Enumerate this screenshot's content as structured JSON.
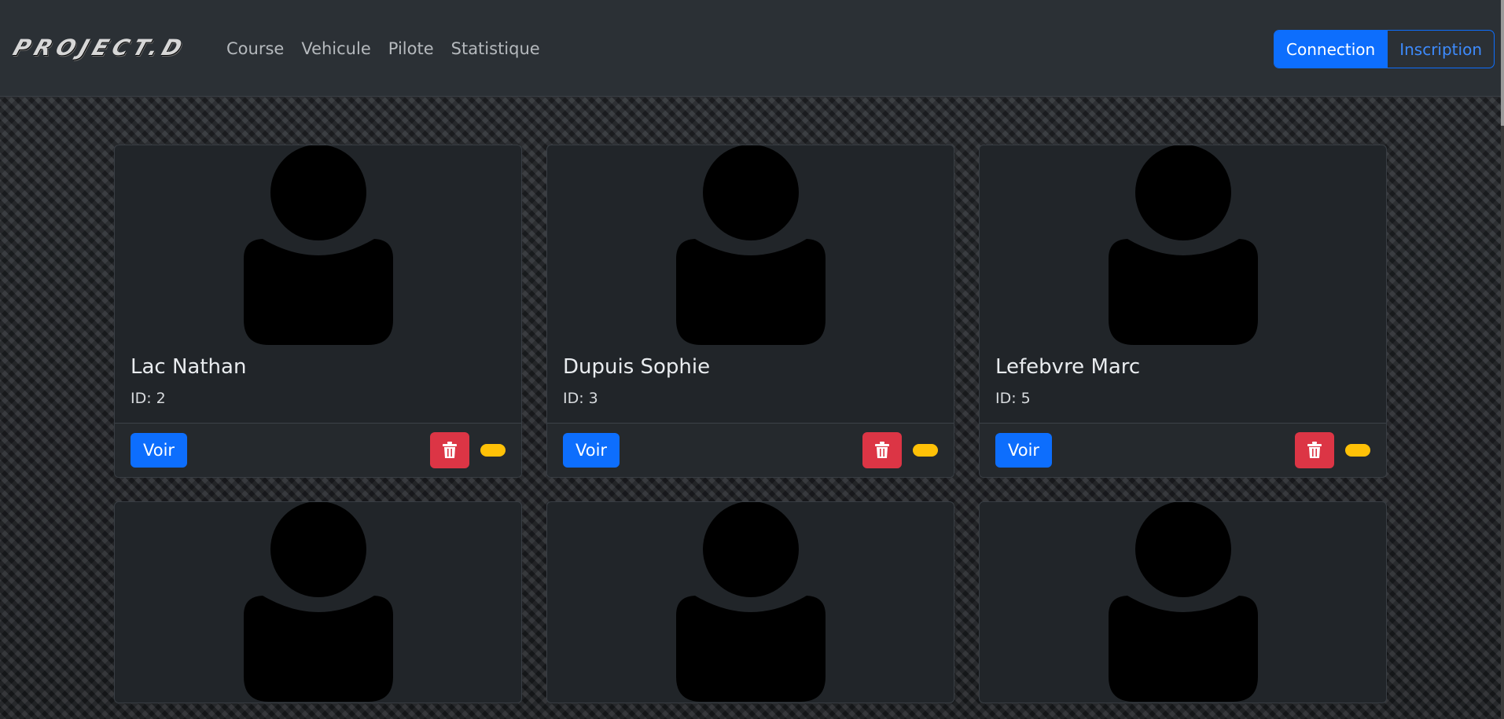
{
  "brand": "PROJECT.D",
  "nav": {
    "links": [
      "Course",
      "Vehicule",
      "Pilote",
      "Statistique"
    ]
  },
  "auth": {
    "connection": "Connection",
    "inscription": "Inscription"
  },
  "cards": [
    {
      "name": "Lac Nathan",
      "id": "ID: 2",
      "view": "Voir"
    },
    {
      "name": "Dupuis Sophie",
      "id": "ID: 3",
      "view": "Voir"
    },
    {
      "name": "Lefebvre Marc",
      "id": "ID: 5",
      "view": "Voir"
    }
  ],
  "icons": {
    "avatar": "person-silhouette-icon",
    "delete": "trash-icon"
  },
  "colors": {
    "primary": "#0d6efd",
    "danger": "#dc3545",
    "warning": "#ffc107",
    "navbar": "#2b3035",
    "card": "#212529"
  }
}
